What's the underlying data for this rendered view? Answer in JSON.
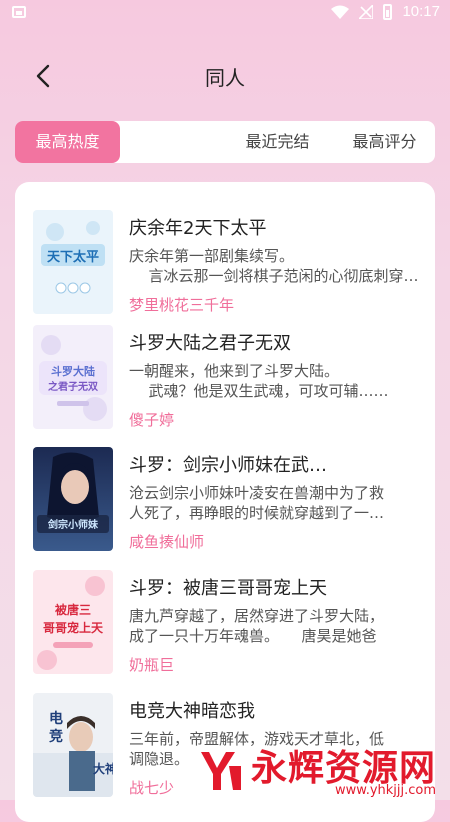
{
  "status_bar": {
    "time": "10:17"
  },
  "header": {
    "title": "同人"
  },
  "tabs": [
    {
      "label": "最高热度"
    },
    {
      "label": "最近完结"
    },
    {
      "label": "最高评分"
    }
  ],
  "books": [
    {
      "title": "庆余年2天下太平",
      "desc_line1": "庆余年第一部剧集续写。",
      "desc_line2": "言冰云那一剑将棋子范闲的心彻底刺穿……",
      "author": "梦里桃花三千年",
      "cover_text": "天下太平"
    },
    {
      "title": "斗罗大陆之君子无双",
      "desc_line1": "一朝醒来，他来到了斗罗大陆。",
      "desc_line2": "武魂？他是双生武魂，可攻可辅……",
      "author": "傻子婷",
      "cover_text": "斗罗大陆之君子无双"
    },
    {
      "title": "斗罗：剑宗小师妹在武…",
      "desc_line1": "沧云剑宗小师妹叶凌安在兽潮中为了救",
      "desc_line2": "人死了，再睁眼的时候就穿越到了一…",
      "author": "咸鱼揍仙师",
      "cover_text": "剑宗小师妹"
    },
    {
      "title": "斗罗：被唐三哥哥宠上天",
      "desc_line1": "唐九芦穿越了，居然穿进了斗罗大陆，",
      "desc_line2": "成了一只十万年魂兽。　　唐昊是她爸",
      "author": "奶瓶巨",
      "cover_text": "被唐三哥哥宠上天"
    },
    {
      "title": "电竞大神暗恋我",
      "desc_line1": "三年前，帝盟解体，游戏天才草北，低",
      "desc_line2": "调隐退。",
      "author": "战七少",
      "cover_text": "电竞大神"
    }
  ],
  "watermark": {
    "text": "永辉资源网",
    "url": "www.yhkjjj.com"
  },
  "colors": {
    "accent": "#f274a0",
    "author": "#f06e9a"
  }
}
